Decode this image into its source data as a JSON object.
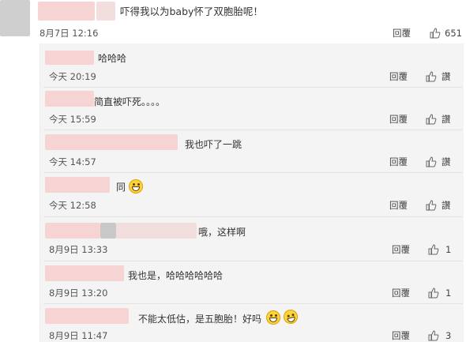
{
  "main_comment": {
    "text": "吓得我以为baby怀了双胞胎呢！",
    "time": "8月7日 12:16",
    "reply_label": "回覆",
    "like_count": "651"
  },
  "replies": [
    {
      "text": "哈哈哈",
      "time": "今天 20:19",
      "reply_label": "回覆",
      "like_label": "讚"
    },
    {
      "text": "简直被吓死。。。。",
      "time": "今天 15:59",
      "reply_label": "回覆",
      "like_label": "讚"
    },
    {
      "text": "我也吓了一跳",
      "time": "今天 14:57",
      "reply_label": "回覆",
      "like_label": "讚"
    },
    {
      "text": "同",
      "time": "今天 12:58",
      "reply_label": "回覆",
      "like_label": "讚"
    },
    {
      "text": "哦，这样啊",
      "time": "8月9日 13:33",
      "reply_label": "回覆",
      "like_label": "1"
    },
    {
      "text": "我也是，哈哈哈哈哈哈",
      "time": "8月9日 13:20",
      "reply_label": "回覆",
      "like_label": "1"
    },
    {
      "text": "不能太低估，是五胞胎！好吗",
      "time": "8月9日 11:47",
      "reply_label": "回覆",
      "like_label": "3"
    }
  ],
  "icons": {
    "like": "thumbs-up-icon",
    "emoji": "grin-emoji-icon",
    "laugh": "laughing-tears-emoji-icon"
  },
  "colors": {
    "panel_bg": "#f4f4f4",
    "redaction_pink": "#f6d4d4"
  }
}
